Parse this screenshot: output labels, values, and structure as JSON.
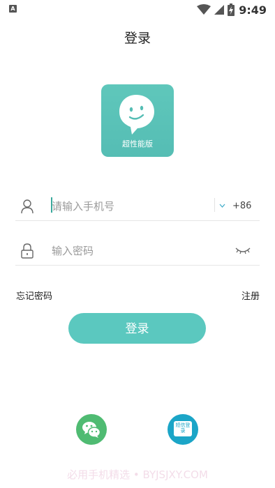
{
  "status_bar": {
    "left_icon": "A",
    "time": "9:49",
    "icons": [
      "wifi-icon",
      "cellular-signal-icon",
      "battery-charging-icon"
    ]
  },
  "header": {
    "title": "登录"
  },
  "logo": {
    "text": "超性能版",
    "icon": "speech-bubble-face-icon",
    "color": "#5bc2b8"
  },
  "form": {
    "phone": {
      "placeholder": "请输入手机号",
      "value": "",
      "country_code": "+86",
      "icon": "user-icon",
      "dropdown_icon": "chevron-down-icon"
    },
    "password": {
      "placeholder": "输入密码",
      "value": "",
      "icon": "lock-icon",
      "toggle_icon": "eye-closed-icon"
    }
  },
  "links": {
    "forgot_password": "忘记密码",
    "register": "注册"
  },
  "login_button": {
    "label": "登录",
    "color": "#5bc8bf"
  },
  "social_login": {
    "wechat": {
      "icon": "wechat-icon",
      "color": "#4fbb72"
    },
    "sms": {
      "label": "短信登录",
      "icon": "sms-icon",
      "color": "#1ba5c7"
    }
  },
  "watermark": "必用手机精选 • BYJSJXY.COM"
}
